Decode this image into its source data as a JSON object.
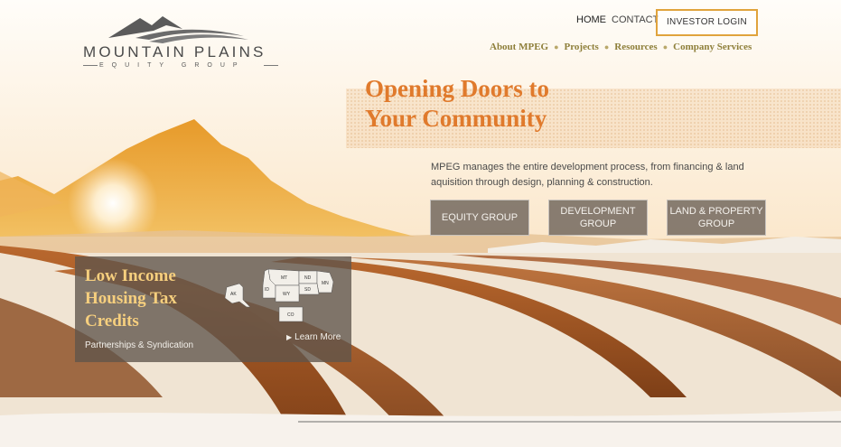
{
  "logo": {
    "name": "MOUNTAIN PLAINS",
    "subtitle": "EQUITY GROUP"
  },
  "nav": {
    "home": "HOME",
    "contact": "CONTACT",
    "investor_login": "INVESTOR LOGIN"
  },
  "subnav": {
    "items": [
      "About MPEG",
      "Projects",
      "Resources",
      "Company Services"
    ]
  },
  "hero": {
    "headline_line1": "Opening Doors to",
    "headline_line2": "Your Community",
    "intro": "MPEG manages the entire development process, from financing & land aquisition through design, planning & construction.",
    "buttons": [
      "EQUITY GROUP",
      "DEVELOPMENT GROUP",
      "LAND & PROPERTY GROUP"
    ]
  },
  "lihtc": {
    "title": "Low Income Housing Tax Credits",
    "subtitle": "Partnerships & Syndication",
    "learn_more": "Learn More",
    "map_states": [
      "AK",
      "MT",
      "ND",
      "MN",
      "ID",
      "SD",
      "WY",
      "CO"
    ]
  },
  "colors": {
    "accent_orange": "#e07a2c",
    "gold_border": "#e0a33c",
    "subnav_olive": "#8e7f3a",
    "title_gold": "#f6cf7e"
  }
}
